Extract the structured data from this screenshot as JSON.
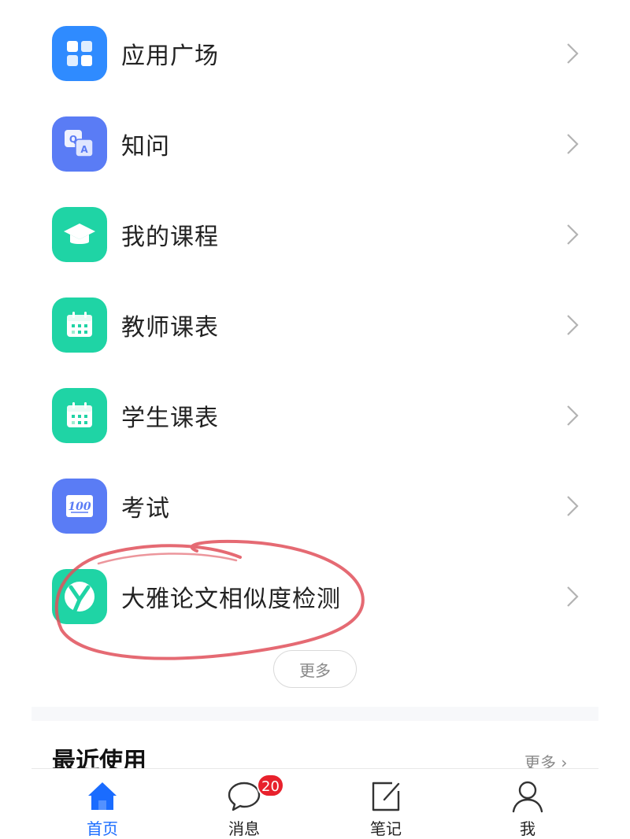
{
  "menu": {
    "items": [
      {
        "label": "应用广场",
        "icon": "app-grid-icon",
        "color": "#2f8bff"
      },
      {
        "label": "知问",
        "icon": "qa-icon",
        "color": "#5a7cf5"
      },
      {
        "label": "我的课程",
        "icon": "graduation-cap-icon",
        "color": "#1fd4a5"
      },
      {
        "label": "教师课表",
        "icon": "calendar-icon",
        "color": "#1fd4a5"
      },
      {
        "label": "学生课表",
        "icon": "calendar-icon",
        "color": "#1fd4a5"
      },
      {
        "label": "考试",
        "icon": "exam-score-icon",
        "color": "#5a7cf5"
      },
      {
        "label": "大雅论文相似度检测",
        "icon": "daya-logo-icon",
        "color": "#1fd4a5"
      }
    ],
    "more_label": "更多"
  },
  "qa_icon_letters": {
    "q": "Q",
    "a": "A"
  },
  "exam_icon_text": "100",
  "recent": {
    "title": "最近使用",
    "more_label": "更多"
  },
  "tabbar": {
    "tabs": [
      {
        "label": "首页",
        "icon": "home-icon",
        "active": true
      },
      {
        "label": "消息",
        "icon": "message-icon",
        "badge": "20"
      },
      {
        "label": "笔记",
        "icon": "note-icon"
      },
      {
        "label": "我",
        "icon": "profile-icon"
      }
    ]
  },
  "colors": {
    "accent": "#1a6cff",
    "badge": "#e8212c",
    "annotation": "#e0505a"
  }
}
